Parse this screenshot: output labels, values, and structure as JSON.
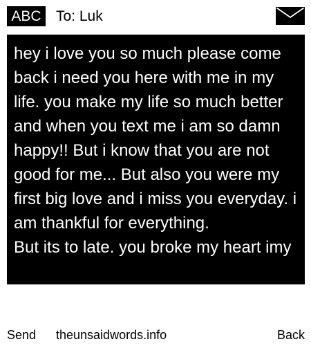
{
  "header": {
    "input_mode": "ABC",
    "recipient": "To: Luk",
    "envelope_icon": "envelope-icon"
  },
  "message": {
    "text": "hey i love you so much please come back i need you here with me in my life. you make my life so much better and when you text me i am so damn happy!! But i know that you are not good for me... But also you were my first big love and i miss you everyday. i am thankful for everything.\nBut its to late. you broke my heart imy"
  },
  "footer": {
    "send_label": "Send",
    "site": "theunsaidwords.info",
    "back_label": "Back"
  },
  "colors": {
    "background": "#ffffff",
    "message_background": "#000000",
    "message_text": "#ffffff"
  }
}
